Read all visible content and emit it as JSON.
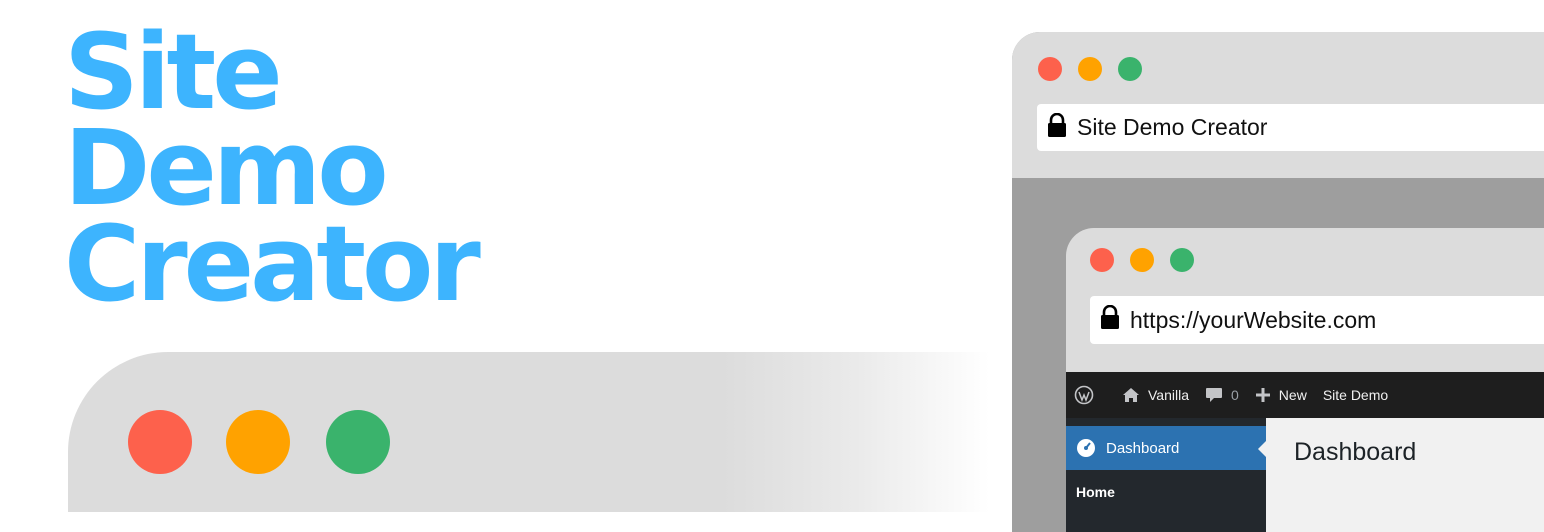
{
  "hero": {
    "title_lines": [
      "Site",
      "Demo",
      "Creator"
    ],
    "color": "#3db4fe"
  },
  "window_controls": {
    "close_color": "#fd614c",
    "minimize_color": "#ffa200",
    "maximize_color": "#3ab36c"
  },
  "outer_browser": {
    "url_text": "Site Demo Creator",
    "lock_icon": "lock-icon"
  },
  "inner_browser": {
    "url_text": "https://yourWebsite.com",
    "lock_icon": "lock-icon"
  },
  "admin_bar": {
    "wp_logo_icon": "wordpress-logo-icon",
    "site_name": "Vanilla",
    "comments_count": "0",
    "new_label": "New",
    "site_demo_label": "Site Demo"
  },
  "sidebar": {
    "active_item": "Dashboard",
    "sub_item": "Home"
  },
  "content": {
    "page_title": "Dashboard"
  }
}
